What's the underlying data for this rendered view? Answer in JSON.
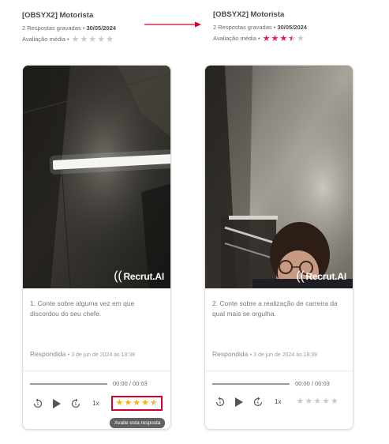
{
  "left": {
    "header": {
      "title": "[OBSYX2] Motorista",
      "responses_text": "2 Respostas gravadas •",
      "responses_date": "30/05/2024",
      "avg_label": "Avaliação média •",
      "avg_rating": 0,
      "avg_star_color": "#c9c9c9"
    },
    "card": {
      "brand": "Recrut.AI",
      "question": "1. Conte sobre alguma vez em que discordou do seu chefe.",
      "answered_label": "Respondida",
      "answered_date": "• 3 de jun de 2024 às 18:38",
      "time": "00:00 / 00:03",
      "speed": "1x",
      "rating": 4.5,
      "rating_color": "#f5b400",
      "tooltip": "Avalie esta resposta"
    }
  },
  "right": {
    "header": {
      "title": "[OBSYX2] Motorista",
      "responses_text": "2 Respostas gravadas •",
      "responses_date": "30/05/2024",
      "avg_label": "Avaliação média •",
      "avg_rating": 3.5,
      "avg_star_color": "#e8175d"
    },
    "card": {
      "brand": "Recrut.AI",
      "question": "2. Conte sobre a realização de carreira da qual mais se orgulha.",
      "answered_label": "Respondida",
      "answered_date": "• 3 de jun de 2024 às 18:39",
      "time": "00:00 / 00:03",
      "speed": "1x",
      "rating": 0,
      "rating_color": "#c9c9c9"
    }
  },
  "icons": {
    "rewind": "rewind-5-icon",
    "play": "play-icon",
    "forward": "forward-5-icon",
    "arrow": "right-arrow-annotation",
    "highlight": "red-highlight-box"
  }
}
